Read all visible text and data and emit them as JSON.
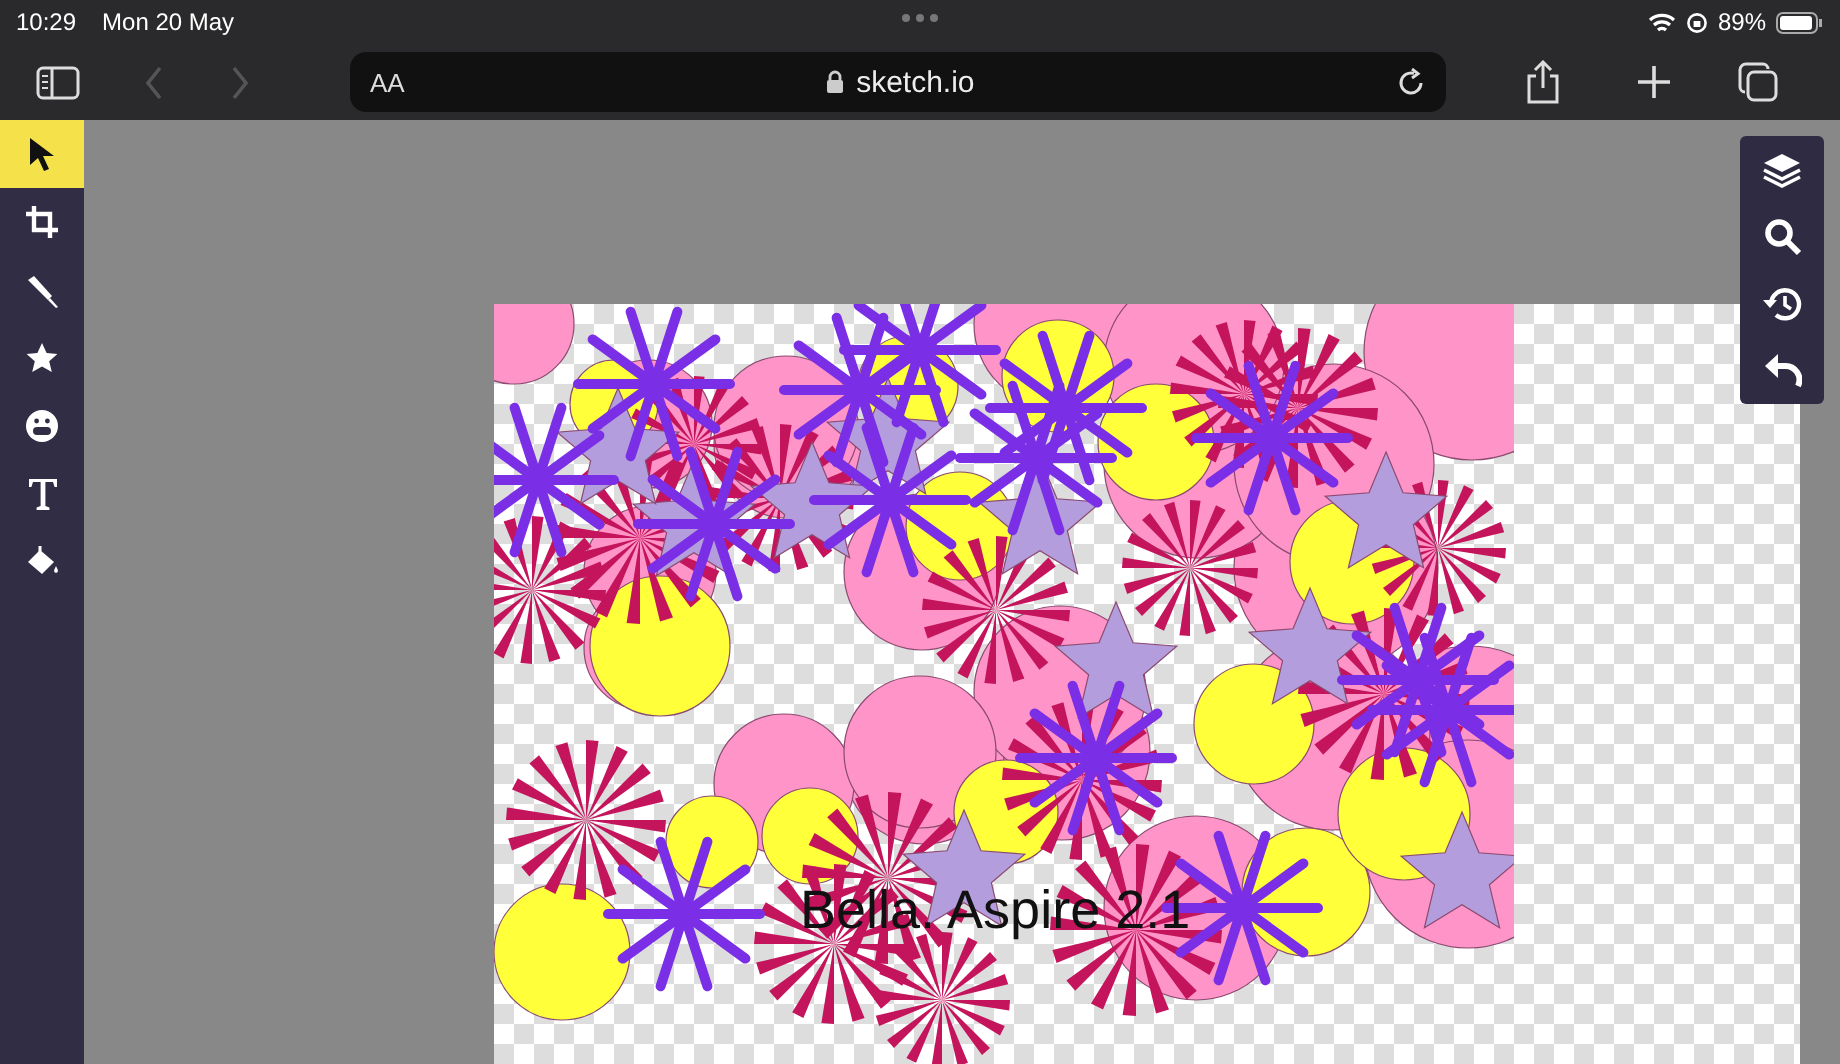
{
  "status_bar": {
    "time": "10:29",
    "date": "Mon 20 May",
    "battery": "89%"
  },
  "browser": {
    "text_size_button": "AA",
    "url": "sketch.io"
  },
  "tools": [
    {
      "kind": "pointer",
      "selected": true
    },
    {
      "kind": "crop",
      "selected": false
    },
    {
      "kind": "brush",
      "selected": false
    },
    {
      "kind": "star",
      "selected": false
    },
    {
      "kind": "emoji",
      "selected": false
    },
    {
      "kind": "text",
      "selected": false
    },
    {
      "kind": "fill",
      "selected": false
    }
  ],
  "canvas": {
    "caption": "Bella. Aspire 2.1"
  }
}
